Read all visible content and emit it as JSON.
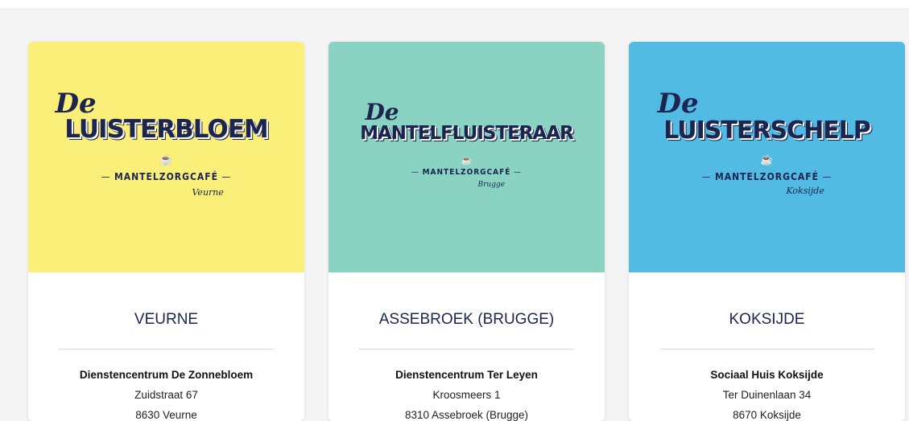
{
  "cards": [
    {
      "bg": "#faef78",
      "logo": {
        "script": "De",
        "name": "LUISTERBLOEM",
        "subtitle": "MANTELZORGCAFÉ",
        "town": "Veurne",
        "cup": "☕"
      },
      "city": "VEURNE",
      "venue": "Dienstencentrum De Zonnebloem",
      "street": "Zuidstraat 67",
      "postal": "8630 Veurne"
    },
    {
      "bg": "#8ad2c2",
      "logo": {
        "script": "De",
        "name": "MANTELFLUISTERAAR",
        "subtitle": "MANTELZORGCAFÉ",
        "town": "Brugge",
        "cup": "☕"
      },
      "city": "ASSEBROEK (BRUGGE)",
      "venue": "Dienstencentrum Ter Leyen",
      "street": "Kroosmeers 1",
      "postal": "8310 Assebroek (Brugge)"
    },
    {
      "bg": "#52bbe4",
      "logo": {
        "script": "De",
        "name": "LUISTERSCHELP",
        "subtitle": "MANTELZORGCAFÉ",
        "town": "Koksijde",
        "cup": "☕"
      },
      "city": "KOKSIJDE",
      "venue": "Sociaal Huis Koksijde",
      "street": "Ter Duinenlaan 34",
      "postal": "8670 Koksijde"
    }
  ],
  "colors": {
    "logo_ink": "#1c2450",
    "divider": "#dcdcdc"
  }
}
